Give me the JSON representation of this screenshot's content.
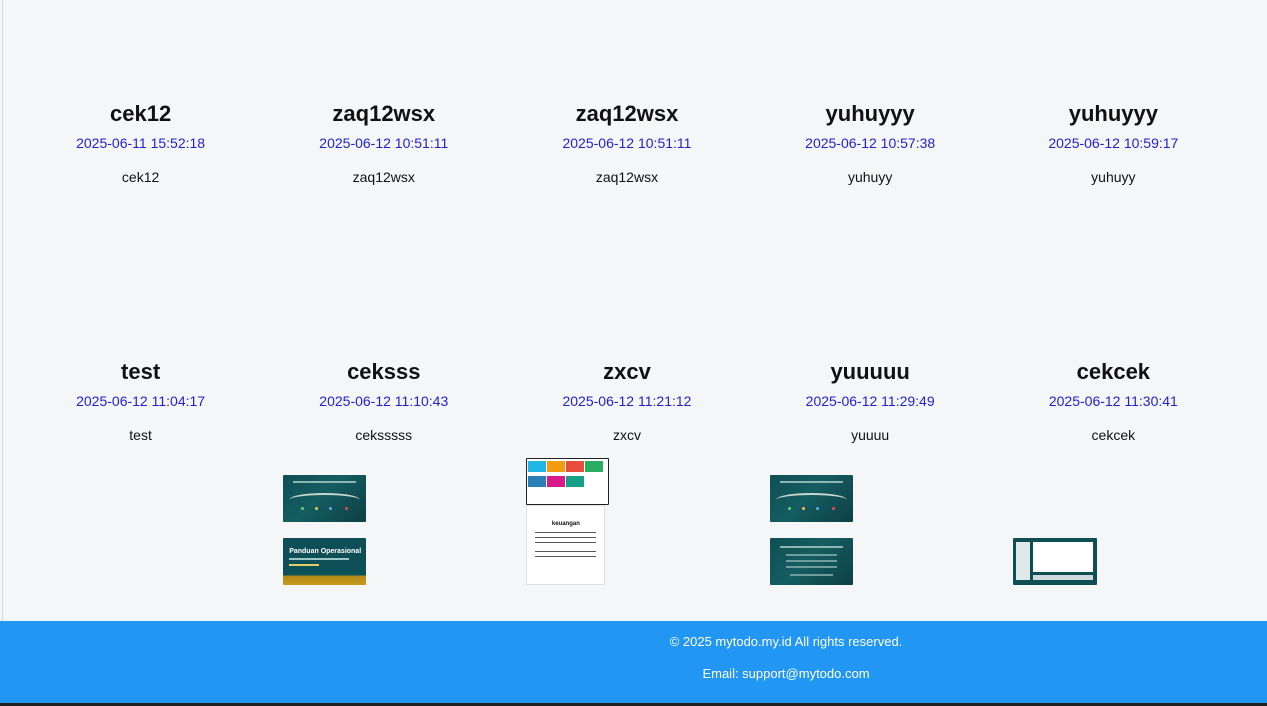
{
  "todos": [
    {
      "title": "cek12",
      "date": "2025-06-11 15:52:18",
      "desc": "cek12"
    },
    {
      "title": "zaq12wsx",
      "date": "2025-06-12 10:51:11",
      "desc": "zaq12wsx"
    },
    {
      "title": "zaq12wsx",
      "date": "2025-06-12 10:51:11",
      "desc": "zaq12wsx"
    },
    {
      "title": "yuhuyyy",
      "date": "2025-06-12 10:57:38",
      "desc": "yuhuyy"
    },
    {
      "title": "yuhuyyy",
      "date": "2025-06-12 10:59:17",
      "desc": "yuhuyy"
    },
    {
      "title": "test",
      "date": "2025-06-12 11:04:17",
      "desc": "test"
    },
    {
      "title": "ceksss",
      "date": "2025-06-12 11:10:43",
      "desc": "ceksssss"
    },
    {
      "title": "zxcv",
      "date": "2025-06-12 11:21:12",
      "desc": "zxcv"
    },
    {
      "title": "yuuuuu",
      "date": "2025-06-12 11:29:49",
      "desc": "yuuuu"
    },
    {
      "title": "cekcek",
      "date": "2025-06-12 11:30:41",
      "desc": "cekcek"
    }
  ],
  "attachments": {
    "ceksss": [
      "slide-thumbnail",
      "manual-thumbnail"
    ],
    "zxcv": [
      "dashboard-thumbnail",
      "document-thumbnail"
    ],
    "yuuuuu": [
      "slide-thumbnail",
      "slide-text-thumbnail"
    ],
    "cekcek": [
      "app-screenshot-thumbnail"
    ]
  },
  "thumbnail_text": {
    "manual_title": "Panduan Operasional",
    "doc_caption": "keuangan"
  },
  "footer": {
    "copyright": "© 2025 mytodo.my.id All rights reserved.",
    "email": "Email: support@mytodo.com"
  },
  "colors": {
    "background": "#f5f6f8",
    "date_text": "#1f1fcf",
    "footer_bg": "#2196f3"
  }
}
